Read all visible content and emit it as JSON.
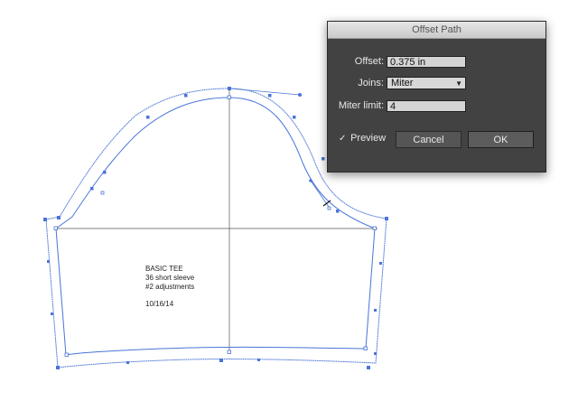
{
  "dialog": {
    "title": "Offset Path",
    "offset_label": "Offset:",
    "offset_value": "0.375 in",
    "joins_label": "Joins:",
    "joins_value": "Miter",
    "miter_label": "Miter limit:",
    "miter_value": "4",
    "preview_label": "Preview",
    "preview_checked": true,
    "cancel_label": "Cancel",
    "ok_label": "OK"
  },
  "pattern": {
    "line1": "BASIC TEE",
    "line2": "36 short sleeve",
    "line3": "#2 adjustments",
    "date": "10/16/14"
  },
  "colors": {
    "path": "#4a74d8",
    "guide": "#555555",
    "dialog_bg": "#424242"
  }
}
